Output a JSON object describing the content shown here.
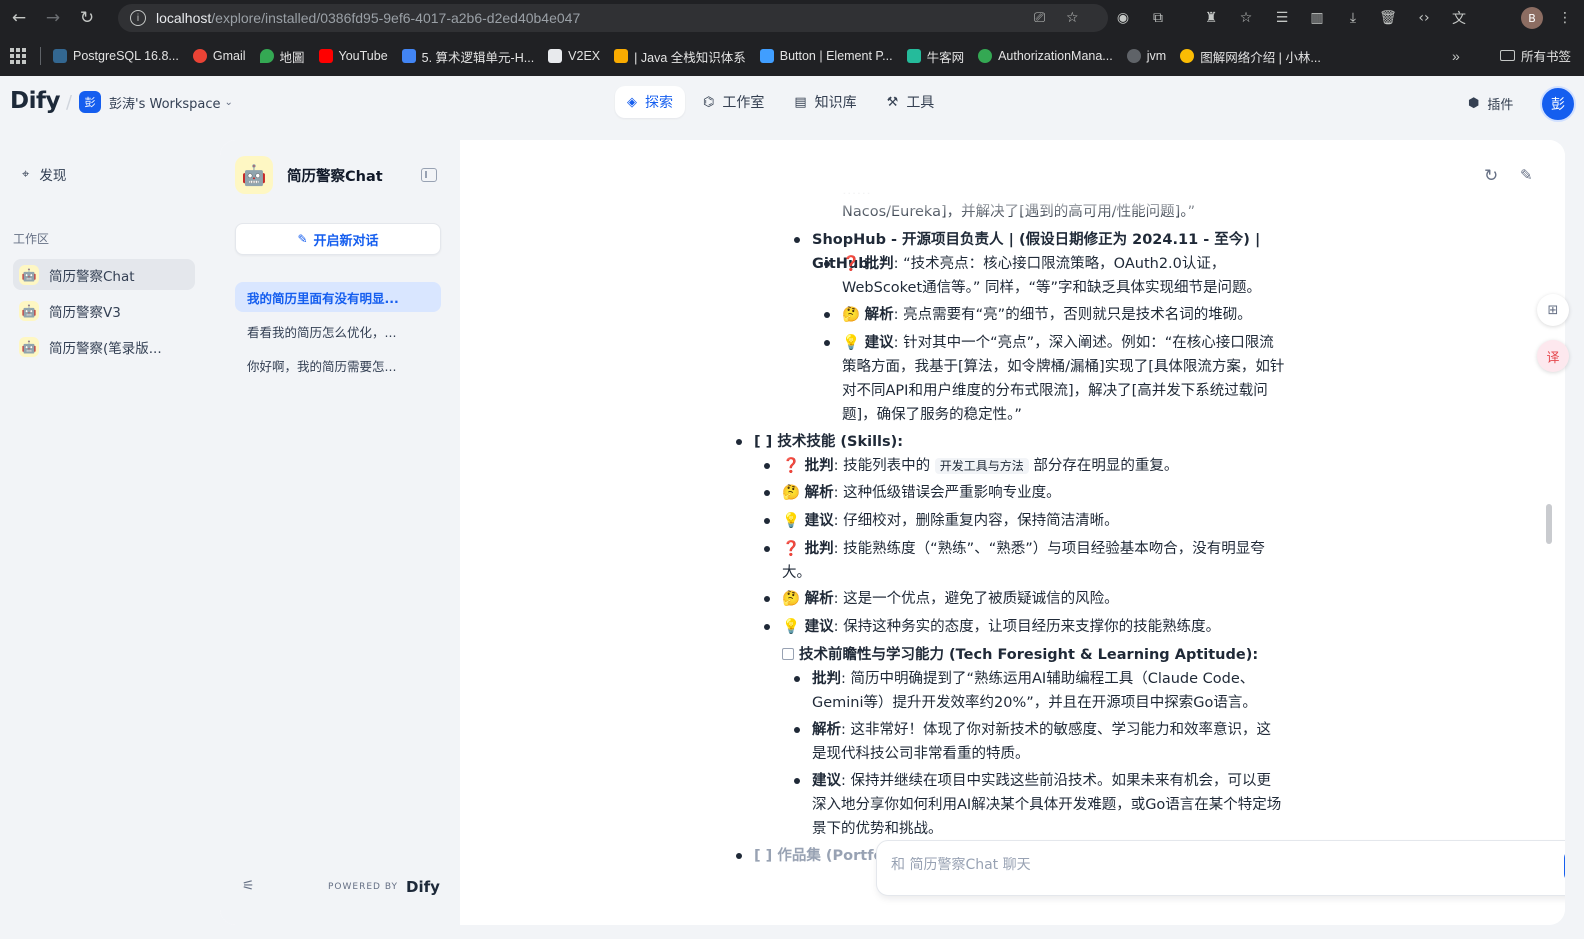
{
  "browser": {
    "url_host": "localhost",
    "url_path": "/explore/installed/0386fd95-9ef6-4017-a2b6-d2ed40b4e047",
    "profile_initial": "B",
    "bookmarks": [
      {
        "label": "PostgreSQL 16.8...",
        "color": "#336791"
      },
      {
        "label": "Gmail",
        "color": "#ea4335"
      },
      {
        "label": "地圖",
        "color": "#34a853"
      },
      {
        "label": "YouTube",
        "color": "#ff0000"
      },
      {
        "label": "5. 算术逻辑单元-H...",
        "color": "#4285f4"
      },
      {
        "label": "V2EX",
        "color": "#e8eaed"
      },
      {
        "label": "| Java 全栈知识体系",
        "color": "#f9ab00"
      },
      {
        "label": "Button | Element P...",
        "color": "#409eff"
      },
      {
        "label": "牛客网",
        "color": "#25bb9b"
      },
      {
        "label": "AuthorizationMana...",
        "color": "#34a853"
      },
      {
        "label": "jvm",
        "color": "#5f6368"
      },
      {
        "label": "图解网络介绍 | 小林...",
        "color": "#fbbc04"
      }
    ],
    "all_bookmarks_label": "所有书签"
  },
  "header": {
    "logo": "Dify",
    "workspace_initial": "彭",
    "workspace_name": "彭涛's Workspace",
    "tabs": [
      {
        "label": "探索",
        "icon": "compass-icon",
        "active": true
      },
      {
        "label": "工作室",
        "icon": "robot-icon",
        "active": false
      },
      {
        "label": "知识库",
        "icon": "book-icon",
        "active": false
      },
      {
        "label": "工具",
        "icon": "hammer-icon",
        "active": false
      }
    ],
    "plugins_label": "插件",
    "user_initial": "彭"
  },
  "sidebar": {
    "discover_label": "发现",
    "workspace_section_label": "工作区",
    "apps": [
      {
        "label": "简历警察Chat",
        "active": true
      },
      {
        "label": "简历警察V3",
        "active": false
      },
      {
        "label": "简历警察(笔录版...",
        "active": false
      }
    ]
  },
  "chat": {
    "app_title": "简历警察Chat",
    "new_chat_label": "开启新对话",
    "conversations": [
      {
        "label": "我的简历里面有没有明显...",
        "active": true
      },
      {
        "label": "看看我的简历怎么优化，...",
        "active": false
      },
      {
        "label": "你好啊，我的简历需要怎...",
        "active": false
      }
    ],
    "powered_by": "POWERED BY",
    "powered_logo": "Dify",
    "input_placeholder": "和 简历警察Chat 聊天"
  },
  "message": {
    "top_line_1": "Nacos/Eureka]，并解决了[遇到的高可用/性能问题]。”",
    "shophub_title": "ShopHub - 开源项目负责人 | (假设日期修正为 2024.11 - 至今) | GitHub",
    "critique_label": "批判",
    "analysis_label": "解析",
    "suggest_label": "建议",
    "q_emoji": "❓",
    "think_emoji": "🤔",
    "bulb_emoji": "💡",
    "shop_crit_1": ": “技术亮点：核心接口限流策略，OAuth2.0认证，",
    "shop_crit_2": "WebScoket通信等。” 同样，“等”字和缺乏具体实现细节是问题。",
    "shop_ana": ": 亮点需要有“亮”的细节，否则就只是技术名词的堆砌。",
    "shop_sug_1": ": 针对其中一个“亮点”，深入阐述。例如：“在核心接口限流",
    "shop_sug_2": "策略方面，我基于[算法，如令牌桶/漏桶]实现了[具体限流方案，如针",
    "shop_sug_3": "对不同API和用户维度的分布式限流]，解决了[高并发下系统过载问",
    "shop_sug_4": "题]，确保了服务的稳定性。”",
    "skills_title": "[ ] 技术技能 (Skills):",
    "sk_crit1_pre": ": 技能列表中的 ",
    "sk_crit1_code": "开发工具与方法",
    "sk_crit1_post": " 部分存在明显的重复。",
    "sk_ana1": ": 这种低级错误会严重影响专业度。",
    "sk_sug1": ": 仔细校对，删除重复内容，保持简洁清晰。",
    "sk_crit2_1": ": 技能熟练度（“熟练”、“熟悉”）与项目经验基本吻合，没有明显夸",
    "sk_crit2_2": "大。",
    "sk_ana2": ": 这是一个优点，避免了被质疑诚信的风险。",
    "sk_sug2": ": 保持这种务实的态度，让项目经历来支撑你的技能熟练度。",
    "tech_title": "技术前瞻性与学习能力 (Tech Foresight & Learning Aptitude):",
    "tech_crit_1": ": 简历中明确提到了“熟练运用AI辅助编程工具（Claude Code、",
    "tech_crit_2": "Gemini等）提升开发效率约20%”，并且在开源项目中探索Go语言。",
    "tech_ana_1": ": 这非常好！体现了你对新技术的敏感度、学习能力和效率意识，这",
    "tech_ana_2": "是现代科技公司非常看重的特质。",
    "tech_sug_1": ": 保持并继续在项目中实践这些前沿技术。如果未来有机会，可以更",
    "tech_sug_2": "深入地分享你如何利用AI解决某个具体开发难题，或Go语言在某个特定场",
    "tech_sug_3": "景下的优势和挑战。",
    "portfolio_title": "[ ] 作品集 (Portfolio):"
  }
}
